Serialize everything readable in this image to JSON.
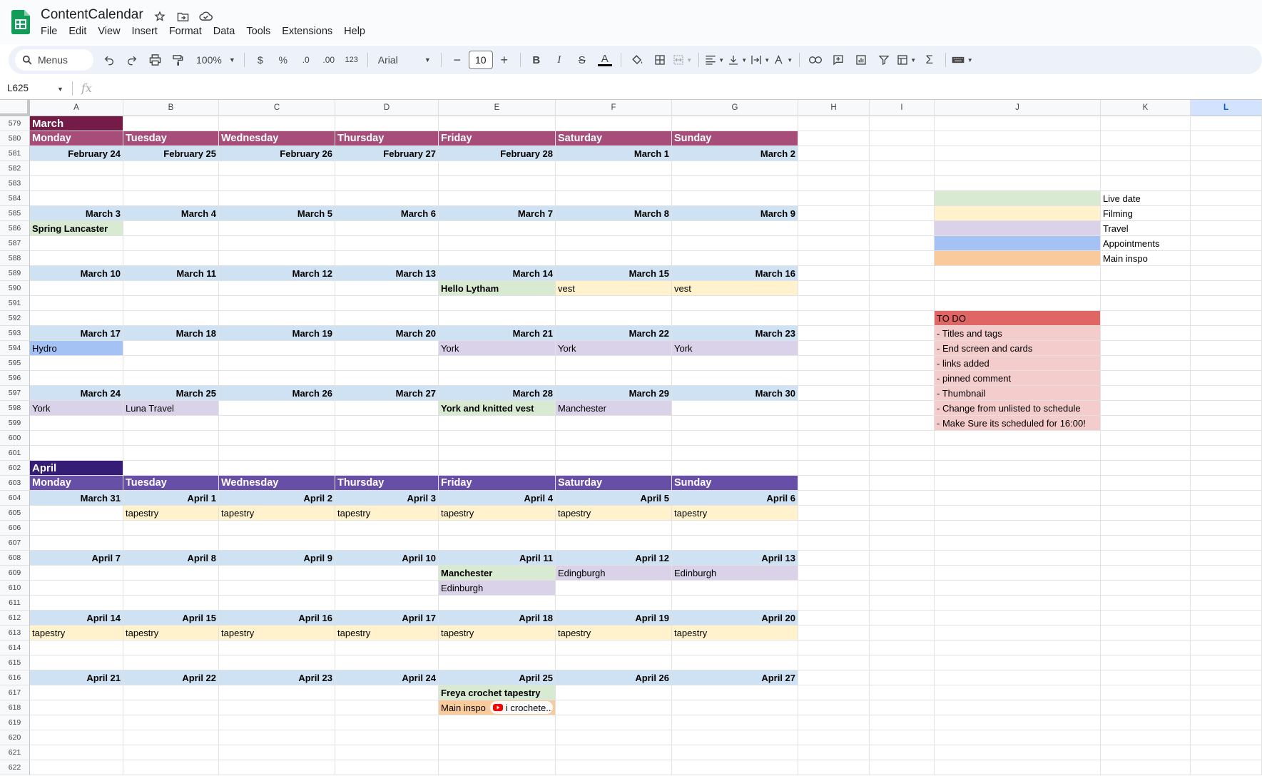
{
  "app": {
    "title": "ContentCalendar",
    "menus": [
      "File",
      "Edit",
      "View",
      "Insert",
      "Format",
      "Data",
      "Tools",
      "Extensions",
      "Help"
    ]
  },
  "toolbar": {
    "search_label": "Menus",
    "zoom": "100%",
    "currency": "$",
    "percent": "%",
    "dec_decrease": ".0",
    "dec_increase": ".00",
    "number_format": "123",
    "font": "Arial",
    "font_size": "10",
    "minus": "−",
    "plus": "+"
  },
  "formula_bar": {
    "name_box": "L625",
    "fx": "fx"
  },
  "colors": {
    "march_month": "#741b47",
    "march_days": "#a64d79",
    "april_month": "#351c75",
    "april_days": "#674ea7",
    "date_row": "#cfe2f3",
    "live": "#d9ead3",
    "filming": "#fff2cc",
    "travel": "#d9d2e9",
    "appointments": "#a4c2f4",
    "main_inspo": "#f9cb9c",
    "todo_header": "#e06666",
    "todo_item": "#f4cccc"
  },
  "grid": {
    "columns": [
      "A",
      "B",
      "C",
      "D",
      "E",
      "F",
      "G",
      "H",
      "I",
      "J",
      "K",
      "L"
    ],
    "selected_column": "L",
    "rows": [
      "579",
      "580",
      "581",
      "582",
      "583",
      "584",
      "585",
      "586",
      "587",
      "588",
      "589",
      "590",
      "591",
      "592",
      "593",
      "594",
      "595",
      "596",
      "597",
      "598",
      "599",
      "600",
      "601",
      "602",
      "603",
      "604",
      "605",
      "606",
      "607",
      "608",
      "609",
      "610",
      "611",
      "612",
      "613",
      "614",
      "615",
      "616",
      "617",
      "618",
      "619",
      "620",
      "621",
      "622"
    ],
    "cells": [
      {
        "r": 0,
        "c": 0,
        "v": "March",
        "s": "month-mar"
      },
      {
        "r": 1,
        "c": 0,
        "v": "Monday",
        "s": "days-mar"
      },
      {
        "r": 1,
        "c": 1,
        "v": "Tuesday",
        "s": "days-mar"
      },
      {
        "r": 1,
        "c": 2,
        "v": "Wednesday",
        "s": "days-mar"
      },
      {
        "r": 1,
        "c": 3,
        "v": "Thursday",
        "s": "days-mar"
      },
      {
        "r": 1,
        "c": 4,
        "v": "Friday",
        "s": "days-mar"
      },
      {
        "r": 1,
        "c": 5,
        "v": "Saturday",
        "s": "days-mar"
      },
      {
        "r": 1,
        "c": 6,
        "v": "Sunday",
        "s": "days-mar"
      },
      {
        "r": 2,
        "c": 0,
        "v": "February 24",
        "s": "date"
      },
      {
        "r": 2,
        "c": 1,
        "v": "February 25",
        "s": "date"
      },
      {
        "r": 2,
        "c": 2,
        "v": "February 26",
        "s": "date"
      },
      {
        "r": 2,
        "c": 3,
        "v": "February 27",
        "s": "date"
      },
      {
        "r": 2,
        "c": 4,
        "v": "February 28",
        "s": "date"
      },
      {
        "r": 2,
        "c": 5,
        "v": "March 1",
        "s": "date"
      },
      {
        "r": 2,
        "c": 6,
        "v": "March 2",
        "s": "date"
      },
      {
        "r": 6,
        "c": 0,
        "v": "March 3",
        "s": "date"
      },
      {
        "r": 6,
        "c": 1,
        "v": "March 4",
        "s": "date"
      },
      {
        "r": 6,
        "c": 2,
        "v": "March 5",
        "s": "date"
      },
      {
        "r": 6,
        "c": 3,
        "v": "March 6",
        "s": "date"
      },
      {
        "r": 6,
        "c": 4,
        "v": "March 7",
        "s": "date"
      },
      {
        "r": 6,
        "c": 5,
        "v": "March 8",
        "s": "date"
      },
      {
        "r": 6,
        "c": 6,
        "v": "March 9",
        "s": "date"
      },
      {
        "r": 7,
        "c": 0,
        "v": "Spring Lancaster",
        "s": "live"
      },
      {
        "r": 10,
        "c": 0,
        "v": "March 10",
        "s": "date"
      },
      {
        "r": 10,
        "c": 1,
        "v": "March 11",
        "s": "date"
      },
      {
        "r": 10,
        "c": 2,
        "v": "March 12",
        "s": "date"
      },
      {
        "r": 10,
        "c": 3,
        "v": "March 13",
        "s": "date"
      },
      {
        "r": 10,
        "c": 4,
        "v": "March 14",
        "s": "date"
      },
      {
        "r": 10,
        "c": 5,
        "v": "March 15",
        "s": "date"
      },
      {
        "r": 10,
        "c": 6,
        "v": "March 16",
        "s": "date"
      },
      {
        "r": 11,
        "c": 4,
        "v": "Hello Lytham",
        "s": "live"
      },
      {
        "r": 11,
        "c": 5,
        "v": "vest",
        "s": "filming"
      },
      {
        "r": 11,
        "c": 6,
        "v": "vest",
        "s": "filming"
      },
      {
        "r": 14,
        "c": 0,
        "v": "March 17",
        "s": "date"
      },
      {
        "r": 14,
        "c": 1,
        "v": "March 18",
        "s": "date"
      },
      {
        "r": 14,
        "c": 2,
        "v": "March 19",
        "s": "date"
      },
      {
        "r": 14,
        "c": 3,
        "v": "March 20",
        "s": "date"
      },
      {
        "r": 14,
        "c": 4,
        "v": "March 21",
        "s": "date"
      },
      {
        "r": 14,
        "c": 5,
        "v": "March 22",
        "s": "date"
      },
      {
        "r": 14,
        "c": 6,
        "v": "March 23",
        "s": "date"
      },
      {
        "r": 15,
        "c": 0,
        "v": "Hydro",
        "s": "appointments"
      },
      {
        "r": 15,
        "c": 4,
        "v": "York",
        "s": "travel"
      },
      {
        "r": 15,
        "c": 5,
        "v": "York",
        "s": "travel"
      },
      {
        "r": 15,
        "c": 6,
        "v": "York",
        "s": "travel"
      },
      {
        "r": 18,
        "c": 0,
        "v": "March 24",
        "s": "date"
      },
      {
        "r": 18,
        "c": 1,
        "v": "March 25",
        "s": "date"
      },
      {
        "r": 18,
        "c": 2,
        "v": "March 26",
        "s": "date"
      },
      {
        "r": 18,
        "c": 3,
        "v": "March 27",
        "s": "date"
      },
      {
        "r": 18,
        "c": 4,
        "v": "March 28",
        "s": "date"
      },
      {
        "r": 18,
        "c": 5,
        "v": "March 29",
        "s": "date"
      },
      {
        "r": 18,
        "c": 6,
        "v": "March 30",
        "s": "date"
      },
      {
        "r": 19,
        "c": 0,
        "v": "York",
        "s": "travel"
      },
      {
        "r": 19,
        "c": 1,
        "v": "Luna Travel",
        "s": "travel"
      },
      {
        "r": 19,
        "c": 4,
        "v": "York and knitted vest",
        "s": "live"
      },
      {
        "r": 19,
        "c": 5,
        "v": "Manchester",
        "s": "travel"
      },
      {
        "r": 23,
        "c": 0,
        "v": "April",
        "s": "month-apr"
      },
      {
        "r": 24,
        "c": 0,
        "v": "Monday",
        "s": "days-apr"
      },
      {
        "r": 24,
        "c": 1,
        "v": "Tuesday",
        "s": "days-apr"
      },
      {
        "r": 24,
        "c": 2,
        "v": "Wednesday",
        "s": "days-apr"
      },
      {
        "r": 24,
        "c": 3,
        "v": "Thursday",
        "s": "days-apr"
      },
      {
        "r": 24,
        "c": 4,
        "v": "Friday",
        "s": "days-apr"
      },
      {
        "r": 24,
        "c": 5,
        "v": "Saturday",
        "s": "days-apr"
      },
      {
        "r": 24,
        "c": 6,
        "v": "Sunday",
        "s": "days-apr"
      },
      {
        "r": 25,
        "c": 0,
        "v": "March 31",
        "s": "date"
      },
      {
        "r": 25,
        "c": 1,
        "v": "April 1",
        "s": "date"
      },
      {
        "r": 25,
        "c": 2,
        "v": "April 2",
        "s": "date"
      },
      {
        "r": 25,
        "c": 3,
        "v": "April 3",
        "s": "date"
      },
      {
        "r": 25,
        "c": 4,
        "v": "April 4",
        "s": "date"
      },
      {
        "r": 25,
        "c": 5,
        "v": "April 5",
        "s": "date"
      },
      {
        "r": 25,
        "c": 6,
        "v": "April 6",
        "s": "date"
      },
      {
        "r": 26,
        "c": 1,
        "v": "tapestry",
        "s": "filming"
      },
      {
        "r": 26,
        "c": 2,
        "v": "tapestry",
        "s": "filming"
      },
      {
        "r": 26,
        "c": 3,
        "v": "tapestry",
        "s": "filming"
      },
      {
        "r": 26,
        "c": 4,
        "v": "tapestry",
        "s": "filming"
      },
      {
        "r": 26,
        "c": 5,
        "v": "tapestry",
        "s": "filming"
      },
      {
        "r": 26,
        "c": 6,
        "v": "tapestry",
        "s": "filming"
      },
      {
        "r": 29,
        "c": 0,
        "v": "April 7",
        "s": "date"
      },
      {
        "r": 29,
        "c": 1,
        "v": "April 8",
        "s": "date"
      },
      {
        "r": 29,
        "c": 2,
        "v": "April 9",
        "s": "date"
      },
      {
        "r": 29,
        "c": 3,
        "v": "April 10",
        "s": "date"
      },
      {
        "r": 29,
        "c": 4,
        "v": "April 11",
        "s": "date"
      },
      {
        "r": 29,
        "c": 5,
        "v": "April 12",
        "s": "date"
      },
      {
        "r": 29,
        "c": 6,
        "v": "April 13",
        "s": "date"
      },
      {
        "r": 30,
        "c": 4,
        "v": "Manchester",
        "s": "live"
      },
      {
        "r": 30,
        "c": 5,
        "v": "Edingburgh",
        "s": "travel"
      },
      {
        "r": 30,
        "c": 6,
        "v": "Edinburgh",
        "s": "travel"
      },
      {
        "r": 31,
        "c": 4,
        "v": "Edinburgh",
        "s": "travel"
      },
      {
        "r": 33,
        "c": 0,
        "v": "April 14",
        "s": "date"
      },
      {
        "r": 33,
        "c": 1,
        "v": "April 15",
        "s": "date"
      },
      {
        "r": 33,
        "c": 2,
        "v": "April 16",
        "s": "date"
      },
      {
        "r": 33,
        "c": 3,
        "v": "April 17",
        "s": "date"
      },
      {
        "r": 33,
        "c": 4,
        "v": "April 18",
        "s": "date"
      },
      {
        "r": 33,
        "c": 5,
        "v": "April 19",
        "s": "date"
      },
      {
        "r": 33,
        "c": 6,
        "v": "April 20",
        "s": "date"
      },
      {
        "r": 34,
        "c": 0,
        "v": "tapestry",
        "s": "filming"
      },
      {
        "r": 34,
        "c": 1,
        "v": "tapestry",
        "s": "filming"
      },
      {
        "r": 34,
        "c": 2,
        "v": "tapestry",
        "s": "filming"
      },
      {
        "r": 34,
        "c": 3,
        "v": "tapestry",
        "s": "filming"
      },
      {
        "r": 34,
        "c": 4,
        "v": "tapestry",
        "s": "filming"
      },
      {
        "r": 34,
        "c": 5,
        "v": "tapestry",
        "s": "filming"
      },
      {
        "r": 34,
        "c": 6,
        "v": "tapestry",
        "s": "filming"
      },
      {
        "r": 37,
        "c": 0,
        "v": "April 21",
        "s": "date"
      },
      {
        "r": 37,
        "c": 1,
        "v": "April 22",
        "s": "date"
      },
      {
        "r": 37,
        "c": 2,
        "v": "April 23",
        "s": "date"
      },
      {
        "r": 37,
        "c": 3,
        "v": "April 24",
        "s": "date"
      },
      {
        "r": 37,
        "c": 4,
        "v": "April 25",
        "s": "date"
      },
      {
        "r": 37,
        "c": 5,
        "v": "April 26",
        "s": "date"
      },
      {
        "r": 37,
        "c": 6,
        "v": "April 27",
        "s": "date"
      },
      {
        "r": 38,
        "c": 4,
        "v": "Freya crochet tapestry",
        "s": "live"
      },
      {
        "r": 39,
        "c": 4,
        "v": "Main inspo",
        "s": "main_inspo",
        "chip": "i crochete..."
      },
      {
        "r": 5,
        "c": 9,
        "v": "",
        "s": "live"
      },
      {
        "r": 5,
        "c": 10,
        "v": "Live date",
        "s": "plain"
      },
      {
        "r": 6,
        "c": 9,
        "v": "",
        "s": "filming"
      },
      {
        "r": 6,
        "c": 10,
        "v": "Filming",
        "s": "plain"
      },
      {
        "r": 7,
        "c": 9,
        "v": "",
        "s": "travel"
      },
      {
        "r": 7,
        "c": 10,
        "v": "Travel",
        "s": "plain"
      },
      {
        "r": 8,
        "c": 9,
        "v": "",
        "s": "appointments"
      },
      {
        "r": 8,
        "c": 10,
        "v": "Appointments",
        "s": "plain"
      },
      {
        "r": 9,
        "c": 9,
        "v": "",
        "s": "main_inspo"
      },
      {
        "r": 9,
        "c": 10,
        "v": "Main inspo",
        "s": "plain"
      },
      {
        "r": 13,
        "c": 9,
        "v": "TO DO",
        "s": "todo_header"
      },
      {
        "r": 14,
        "c": 9,
        "v": "- Titles and tags",
        "s": "todo_item"
      },
      {
        "r": 15,
        "c": 9,
        "v": "- End screen and cards",
        "s": "todo_item"
      },
      {
        "r": 16,
        "c": 9,
        "v": "- links added",
        "s": "todo_item"
      },
      {
        "r": 17,
        "c": 9,
        "v": "- pinned comment",
        "s": "todo_item"
      },
      {
        "r": 18,
        "c": 9,
        "v": "- Thumbnail",
        "s": "todo_item"
      },
      {
        "r": 19,
        "c": 9,
        "v": "- Change from unlisted to schedule",
        "s": "todo_item"
      },
      {
        "r": 20,
        "c": 9,
        "v": "- Make Sure its scheduled for 16:00!",
        "s": "todo_item"
      }
    ]
  }
}
